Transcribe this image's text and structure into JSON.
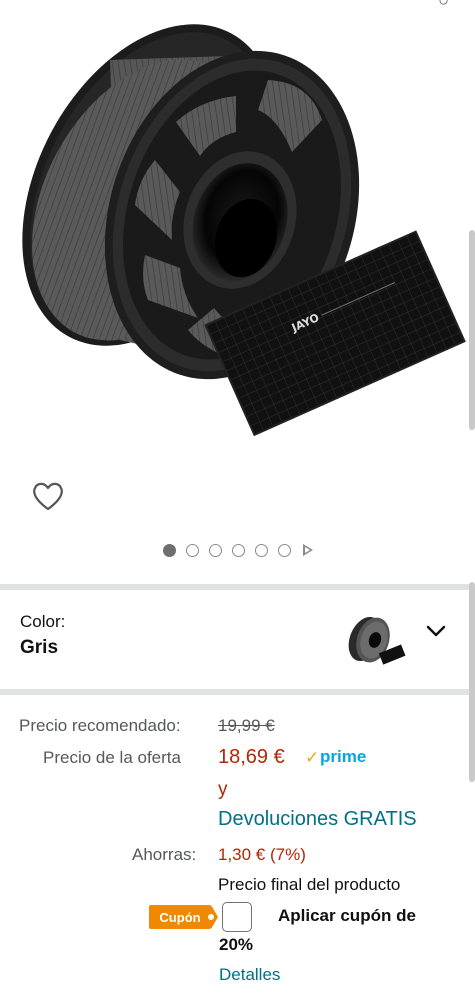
{
  "product": {
    "image_alt": "JAYO spool of grey filament with printing mat",
    "mat_brand": "JAYO",
    "image_count": 6,
    "active_image_index": 0
  },
  "color": {
    "label": "Color:",
    "value": "Gris"
  },
  "pricing": {
    "recommended_label": "Precio recomendado:",
    "recommended_price": "19,99 €",
    "offer_label": "Precio de la oferta",
    "offer_price": "18,69 €",
    "prime_check": "✓",
    "prime_text": "prime",
    "and_text": "y",
    "returns_text": "Devoluciones GRATIS",
    "savings_label": "Ahorras:",
    "savings_value": "1,30 € (7%)",
    "final_price_text": "Precio final del producto"
  },
  "coupon": {
    "badge_text": "Cupón",
    "apply_text": "Aplicar cupón de",
    "discount_text": "20%",
    "details_link": "Detalles"
  },
  "colors": {
    "price_red": "#b12704",
    "link_teal": "#007185",
    "prime_blue": "#00a8e1",
    "coupon_orange": "#f08804"
  }
}
